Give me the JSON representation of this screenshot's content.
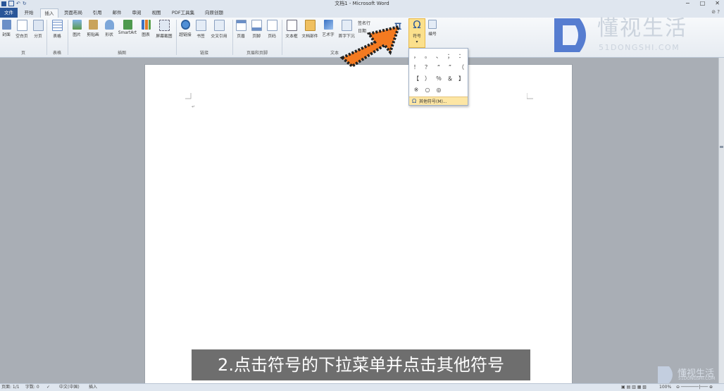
{
  "window": {
    "title": "文档1 - Microsoft Word"
  },
  "qat": {
    "save_icon": "save-icon",
    "undo_icon": "undo-icon",
    "redo_icon": "redo-icon"
  },
  "tabs": [
    "文件",
    "开始",
    "插入",
    "页面布局",
    "引用",
    "邮件",
    "审阅",
    "视图",
    "PDF工具集",
    "向原创题"
  ],
  "active_tab": "插入",
  "ribbon": {
    "groups": [
      "页",
      "表格",
      "插图",
      "链接",
      "页眉和页脚",
      "文本"
    ],
    "buttons": [
      "封面",
      "空白页",
      "分页",
      "表格",
      "图片",
      "剪贴画",
      "形状",
      "SmartArt",
      "图表",
      "屏幕截图",
      "超链接",
      "书签",
      "交叉引用",
      "页眉",
      "页脚",
      "页码",
      "文本框",
      "文档部件",
      "艺术字",
      "首字下沉",
      "签名行",
      "日期",
      "符号",
      "编号"
    ],
    "equation_glyph": "π",
    "symbol_glyph": "Ω"
  },
  "dropdown": {
    "symbols": [
      "，",
      "。",
      "、",
      "；",
      "：",
      "！",
      "？",
      "“",
      "”",
      "（",
      "【",
      "）",
      "％",
      "＆",
      "】",
      "※",
      "○",
      "◎"
    ],
    "more_label": "其他符号(M)...",
    "more_glyph": "Ω"
  },
  "logo": {
    "text": "懂视生活",
    "sub": "51DONGSHI.COM"
  },
  "caption": "2.点击符号的下拉菜单并点击其他符号",
  "statusbar": {
    "page": "页面: 1/1",
    "words": "字数: 0",
    "lang": "中文(中国)",
    "mode": "插入",
    "zoom": "100%"
  },
  "watermark": {
    "text": "懂视生活",
    "sub": "51DONGSHI.COM"
  },
  "colors": {
    "accent": "#2a5699",
    "arrow": "#f47a20",
    "highlight": "#fbe08c"
  }
}
